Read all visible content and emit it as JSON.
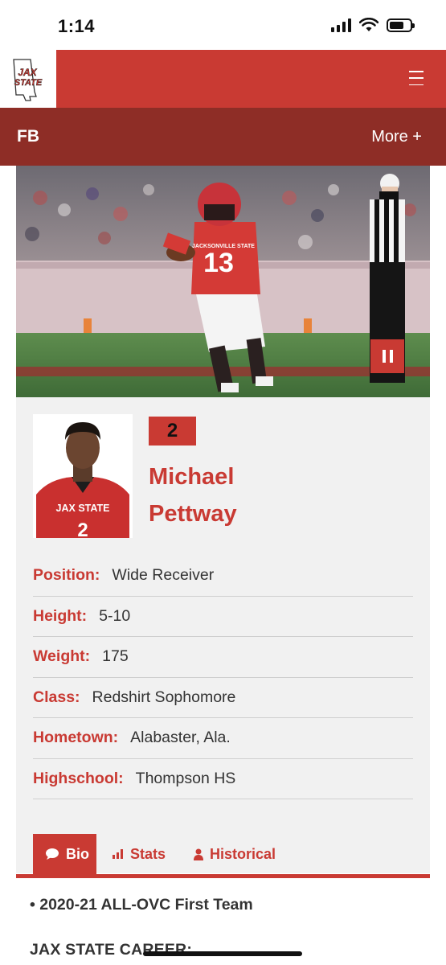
{
  "status_bar": {
    "time": "1:14"
  },
  "header": {
    "logo_text_line1": "JAX",
    "logo_text_line2": "STATE",
    "menu_icon": "hamburger-icon"
  },
  "sub_nav": {
    "sport": "FB",
    "more": "More +"
  },
  "player": {
    "number": "2",
    "first_name": "Michael",
    "last_name": "Pettway",
    "hero_jersey_number": "13",
    "hero_jersey_text": "JACKSONVILLE STATE",
    "headshot_jersey_text": "JAX STATE"
  },
  "info": [
    {
      "label": "Position:",
      "value": "Wide Receiver"
    },
    {
      "label": "Height:",
      "value": "5-10"
    },
    {
      "label": "Weight:",
      "value": "175"
    },
    {
      "label": "Class:",
      "value": "Redshirt Sophomore"
    },
    {
      "label": "Hometown:",
      "value": "Alabaster, Ala."
    },
    {
      "label": "Highschool:",
      "value": "Thompson HS"
    }
  ],
  "tabs": [
    {
      "label": "Bio",
      "icon": "speech-bubble-icon",
      "active": true
    },
    {
      "label": "Stats",
      "icon": "bar-chart-icon",
      "active": false
    },
    {
      "label": "Historical",
      "icon": "person-icon",
      "active": false
    }
  ],
  "bio": {
    "item": "• 2020-21 ALL-OVC First Team",
    "career_heading": "JAX STATE CAREER:"
  },
  "colors": {
    "primary": "#c93a33",
    "dark": "#8e2d26",
    "card": "#f1f1f1"
  }
}
